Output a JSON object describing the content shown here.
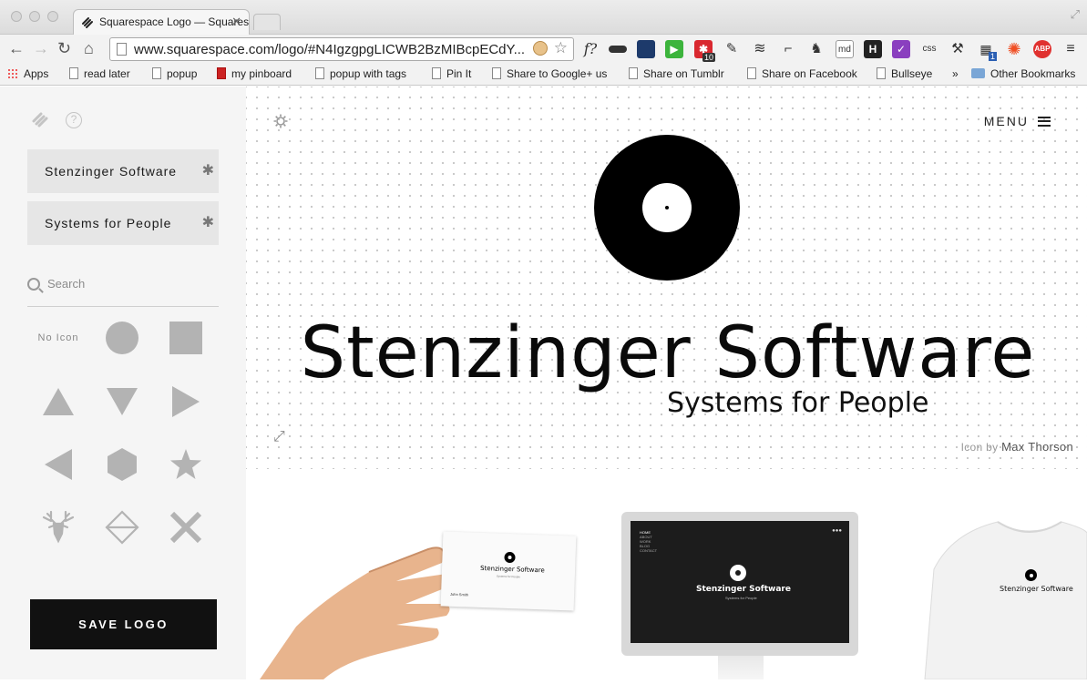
{
  "browser": {
    "tab_title": "Squarespace Logo — Squarespace",
    "url": "www.squarespace.com/logo/#N4IgzgpgLICWB2BzMIBcpECdY...",
    "bookmarks": [
      "Apps",
      "read later",
      "popup",
      "my pinboard",
      "popup with tags",
      "Pin It",
      "Share to Google+ us",
      "Share on Tumblr",
      "Share on Facebook",
      "Bullseye",
      "»",
      "Other Bookmarks"
    ],
    "extensions": {
      "f_label": "f?",
      "md_label": "md",
      "h_label": "H",
      "css_label": "css",
      "badge_count": "10",
      "abp_label": "ABP",
      "clipper_count": "1"
    }
  },
  "sidebar": {
    "fields": [
      {
        "label": "Stenzinger Software"
      },
      {
        "label": "Systems for People"
      }
    ],
    "search_placeholder": "Search",
    "icon_options": {
      "no_icon_label": "No Icon",
      "shapes": [
        "circle",
        "square",
        "triangle-up",
        "triangle-down",
        "triangle-right",
        "triangle-left",
        "hexagon",
        "star",
        "deer-head",
        "diamond",
        "x"
      ]
    },
    "save_button_label": "SAVE LOGO"
  },
  "main": {
    "menu_label": "MENU",
    "logo": {
      "title": "Stenzinger Software",
      "tagline": "Systems for People"
    },
    "credit": {
      "prefix": "Icon by",
      "author": "Max Thorson"
    },
    "mockups": {
      "card_name": "Stenzinger Software",
      "card_tagline": "Systems for People",
      "card_contact_name": "John Smith",
      "screen_nav": [
        "HOME",
        "ABOUT",
        "WORK",
        "BLOG",
        "CONTACT"
      ],
      "screen_title": "Stenzinger Software",
      "screen_tagline": "Systems for People",
      "shirt_title": "Stenzinger Software"
    }
  }
}
